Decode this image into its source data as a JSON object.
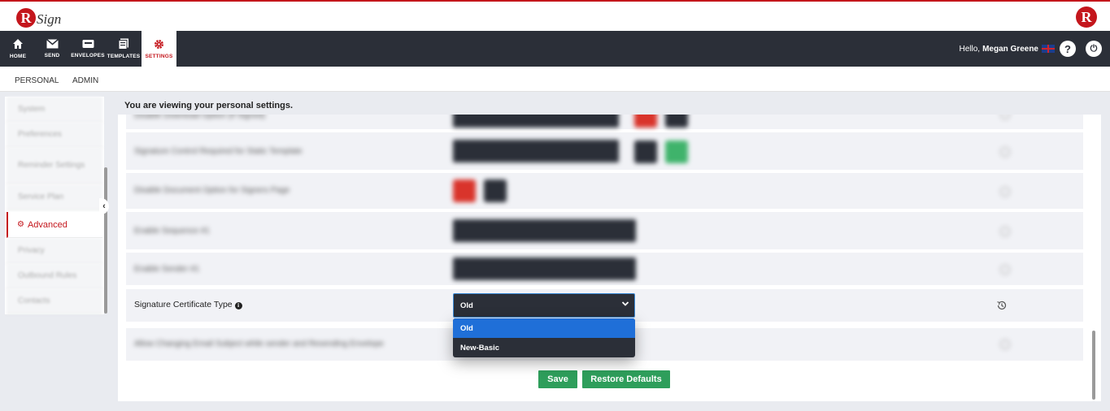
{
  "brand": {
    "logo_letter": "R",
    "logo_text": "Sign"
  },
  "nav": {
    "items": [
      {
        "label": "HOME",
        "icon": "home-icon"
      },
      {
        "label": "SEND",
        "icon": "envelope-icon"
      },
      {
        "label": "ENVELOPES",
        "icon": "inbox-icon"
      },
      {
        "label": "TEMPLATES",
        "icon": "templates-icon"
      },
      {
        "label": "SETTINGS",
        "icon": "gear-icon"
      }
    ],
    "greeting": "Hello,",
    "user_name": "Megan Greene",
    "help_glyph": "?",
    "power_glyph": "⏻"
  },
  "subtabs": [
    "PERSONAL",
    "ADMIN"
  ],
  "sidebar": {
    "items": [
      {
        "label": "System",
        "active": false
      },
      {
        "label": "Preferences",
        "active": false
      },
      {
        "label": "Reminder Settings",
        "active": false
      },
      {
        "label": "Service Plan",
        "active": false
      },
      {
        "label": "Advanced",
        "active": true
      },
      {
        "label": "Privacy",
        "active": false
      },
      {
        "label": "Outbound Rules",
        "active": false
      },
      {
        "label": "Contacts",
        "active": false
      }
    ]
  },
  "panel": {
    "header": "You are viewing your personal settings.",
    "blurred_rows": [
      "Disable Download Option (if Signed)",
      "Signature Control Required for Static Template",
      "Disable Document Option for Signers Page",
      "Enable Sequence #1",
      "Enable Sender #1"
    ],
    "last_blurred_row": "Allow Changing Email Subject while sender and Resending Envelope",
    "cert_row": {
      "label": "Signature Certificate Type",
      "info_glyph": "i",
      "selected": "Old",
      "options": [
        "Old",
        "New-Basic"
      ]
    },
    "save_label": "Save",
    "restore_label": "Restore Defaults"
  },
  "colors": {
    "brand_red": "#c4161c",
    "nav_dark": "#2b2f38",
    "green": "#2e9e5b",
    "highlight_blue": "#1f6fd8"
  }
}
